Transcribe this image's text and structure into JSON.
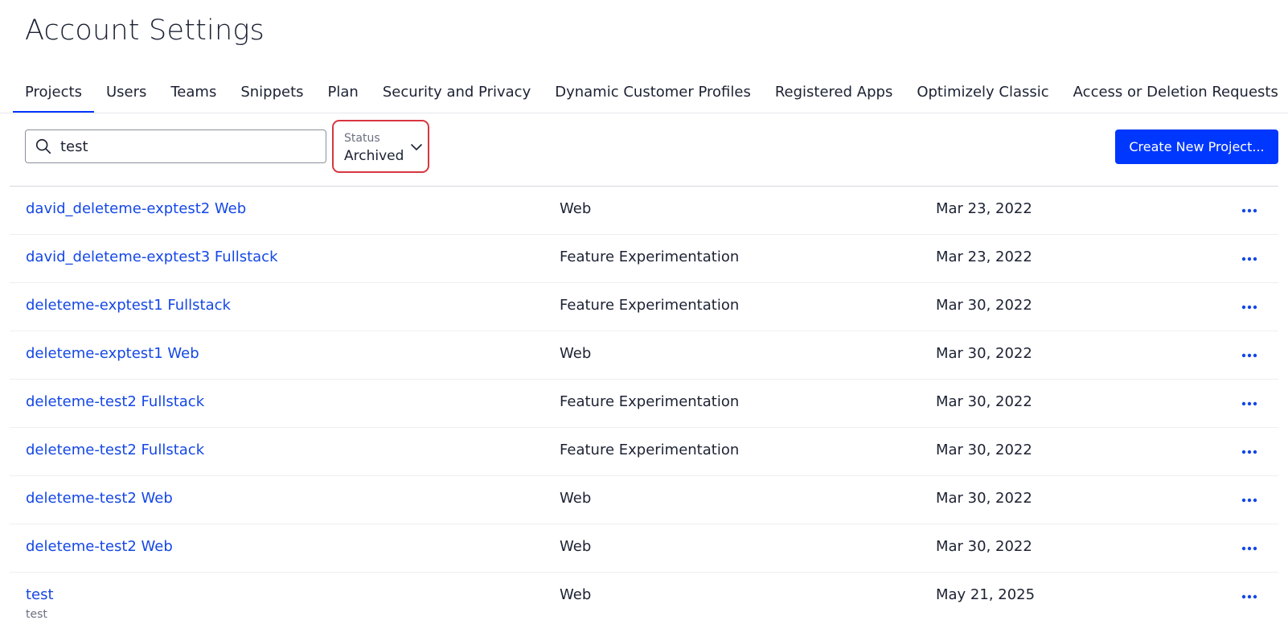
{
  "page": {
    "title": "Account Settings"
  },
  "tabs": [
    {
      "label": "Projects",
      "active": true
    },
    {
      "label": "Users"
    },
    {
      "label": "Teams"
    },
    {
      "label": "Snippets"
    },
    {
      "label": "Plan"
    },
    {
      "label": "Security and Privacy"
    },
    {
      "label": "Dynamic Customer Profiles"
    },
    {
      "label": "Registered Apps"
    },
    {
      "label": "Optimizely Classic"
    },
    {
      "label": "Access or Deletion Requests"
    }
  ],
  "search": {
    "value": "test"
  },
  "status_filter": {
    "label": "Status",
    "value": "Archived"
  },
  "actions": {
    "create_label": "Create New Project..."
  },
  "colors": {
    "accent": "#0037ff",
    "link": "#1447e6",
    "highlight": "#d8363f"
  },
  "projects": [
    {
      "name": "david_deleteme-exptest2 Web",
      "platform": "Web",
      "date": "Mar 23, 2022"
    },
    {
      "name": "david_deleteme-exptest3 Fullstack",
      "platform": "Feature Experimentation",
      "date": "Mar 23, 2022"
    },
    {
      "name": "deleteme-exptest1 Fullstack",
      "platform": "Feature Experimentation",
      "date": "Mar 30, 2022"
    },
    {
      "name": "deleteme-exptest1 Web",
      "platform": "Web",
      "date": "Mar 30, 2022"
    },
    {
      "name": "deleteme-test2 Fullstack",
      "platform": "Feature Experimentation",
      "date": "Mar 30, 2022"
    },
    {
      "name": "deleteme-test2 Fullstack",
      "platform": "Feature Experimentation",
      "date": "Mar 30, 2022"
    },
    {
      "name": "deleteme-test2 Web",
      "platform": "Web",
      "date": "Mar 30, 2022"
    },
    {
      "name": "deleteme-test2 Web",
      "platform": "Web",
      "date": "Mar 30, 2022"
    },
    {
      "name": "test",
      "description": "test",
      "platform": "Web",
      "date": "May 21, 2025"
    }
  ]
}
